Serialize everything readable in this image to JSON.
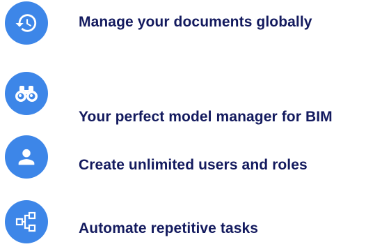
{
  "theme": {
    "icon_color": "#3d86e8",
    "text_color": "#131a5e",
    "background": "#ffffff"
  },
  "features": [
    {
      "icon": "history-icon",
      "label": "Manage your documents globally"
    },
    {
      "icon": "binoculars-icon",
      "label": "Your perfect model manager for BIM"
    },
    {
      "icon": "user-icon",
      "label": "Create unlimited users and roles"
    },
    {
      "icon": "workflow-icon",
      "label": "Automate repetitive tasks"
    }
  ]
}
